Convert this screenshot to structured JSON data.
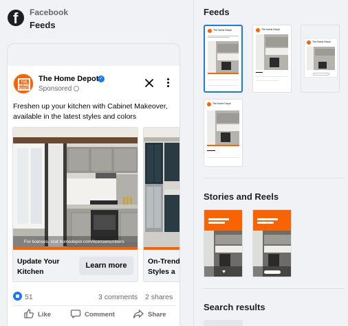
{
  "app": {
    "platform": "Facebook",
    "placement": "Feeds"
  },
  "post": {
    "page_name": "The Home Depot",
    "sponsored_label": "Sponsored",
    "avatar_text": "THE HOME DEPOT",
    "primary_text": "Freshen up your kitchen with Cabinet Makeover, available in the latest styles and colors",
    "cards": [
      {
        "headline": "Update Your Kitchen",
        "cta": "Learn more",
        "overlay": "For licenses, visit homedepot.com/licensenumbers"
      },
      {
        "headline": "On-Trend Styles a",
        "cta": "",
        "overlay": ""
      }
    ],
    "reaction_count": "51",
    "comments": "3 comments",
    "shares": "2 shares",
    "actions": {
      "like": "Like",
      "comment": "Comment",
      "share": "Share"
    }
  },
  "placements_panel": {
    "sections": [
      {
        "title": "Feeds"
      },
      {
        "title": "Stories and Reels"
      },
      {
        "title": "Search results"
      }
    ],
    "mini_page_name": "The Home Depot"
  },
  "colors": {
    "brand_orange": "#f96302",
    "facebook_blue": "#1877f2",
    "background": "#f0f2f5"
  },
  "icons": {
    "logo": "facebook-logo-icon",
    "verified": "verified-badge-icon",
    "close": "close-icon",
    "more": "more-vertical-icon",
    "like": "like-icon",
    "comment": "comment-icon",
    "share": "share-icon"
  }
}
